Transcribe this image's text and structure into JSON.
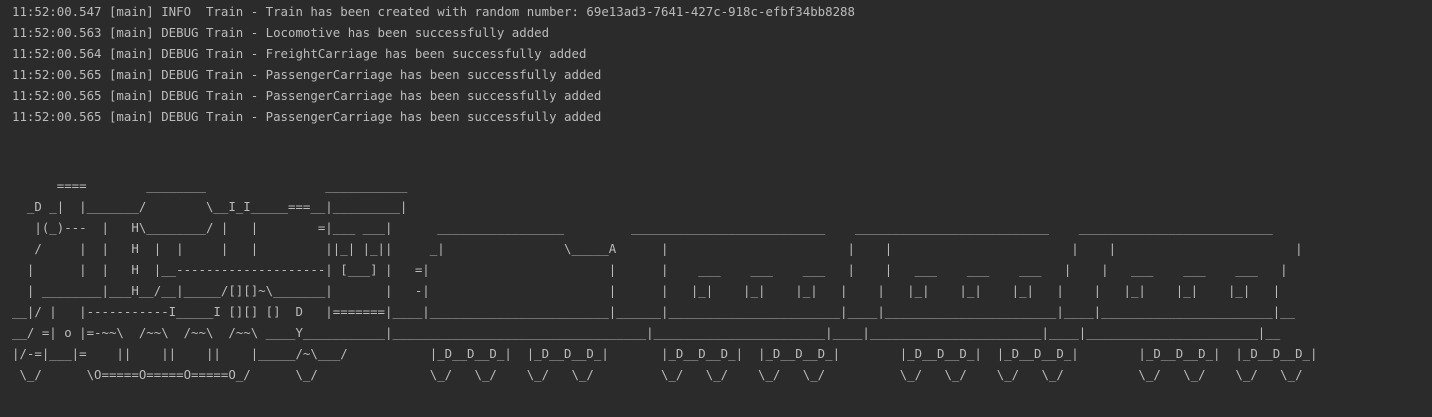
{
  "console": {
    "log_lines": [
      "11:52:00.547 [main] INFO  Train - Train has been created with random number: 69e13ad3-7641-427c-918c-efbf34bb8288",
      "11:52:00.563 [main] DEBUG Train - Locomotive has been successfully added",
      "11:52:00.564 [main] DEBUG Train - FreightCarriage has been successfully added",
      "11:52:00.565 [main] DEBUG Train - PassengerCarriage has been successfully added",
      "11:52:00.565 [main] DEBUG Train - PassengerCarriage has been successfully added",
      "11:52:00.565 [main] DEBUG Train - PassengerCarriage has been successfully added"
    ],
    "ascii_train": [
      "      ====        ________                ___________",
      "  _D _|  |_______/        \\__I_I_____===__|_________|",
      "   |(_)---  |   H\\________/ |   |        =|___ ___|      _________________         __________________________    __________________________    __________________________",
      "   /     |  |   H  |  |     |   |         ||_| |_||     _|                \\_____A      |                        |    |                        |    |                        |",
      "  |      |  |   H  |__--------------------| [___] |   =|                        |      |    ___    ___    ___   |    |   ___    ___    ___   |    |   ___    ___    ___   |",
      "  | ________|___H__/__|_____/[][]~\\_______|       |   -|                        |      |   |_|    |_|    |_|   |    |   |_|    |_|    |_|   |    |   |_|    |_|    |_|   |",
      "__|/ |   |-----------I_____I [][] []  D   |=======|____|________________________|______|_______________________|____|_______________________|____|_______________________|__",
      "__/ =| o |=-~~\\  /~~\\  /~~\\  /~~\\ ____Y___________|__________________________________|_______________________|____|_______________________|____|_______________________|__",
      "|/-=|___|=    ||    ||    ||    |_____/~\\___/           |_D__D__D_|  |_D__D__D_|       |_D__D__D_|  |_D__D__D_|        |_D__D__D_|  |_D__D__D_|        |_D__D__D_|  |_D__D__D_|",
      " \\_/      \\O=====O=====O=====O_/      \\_/               \\_/   \\_/    \\_/   \\_/         \\_/   \\_/    \\_/   \\_/          \\_/   \\_/    \\_/   \\_/          \\_/   \\_/    \\_/   \\_/"
    ]
  }
}
